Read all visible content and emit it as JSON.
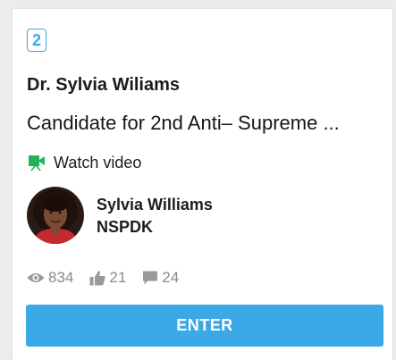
{
  "card": {
    "rank": "2",
    "name": "Dr. Sylvia Wiliams",
    "headline": "Candidate for 2nd Anti– Supreme ...",
    "watch_video_label": "Watch video",
    "author": {
      "name": "Sylvia Williams",
      "org": "NSPDK"
    },
    "stats": {
      "views": "834",
      "likes": "21",
      "comments": "24"
    },
    "enter_label": "ENTER"
  },
  "colors": {
    "accent": "#3aa9e6",
    "video_icon": "#1fb35a",
    "stat_icon": "#9a9a9a"
  },
  "icons": [
    "video-camera-icon",
    "eye-icon",
    "thumbs-up-icon",
    "comment-icon"
  ]
}
